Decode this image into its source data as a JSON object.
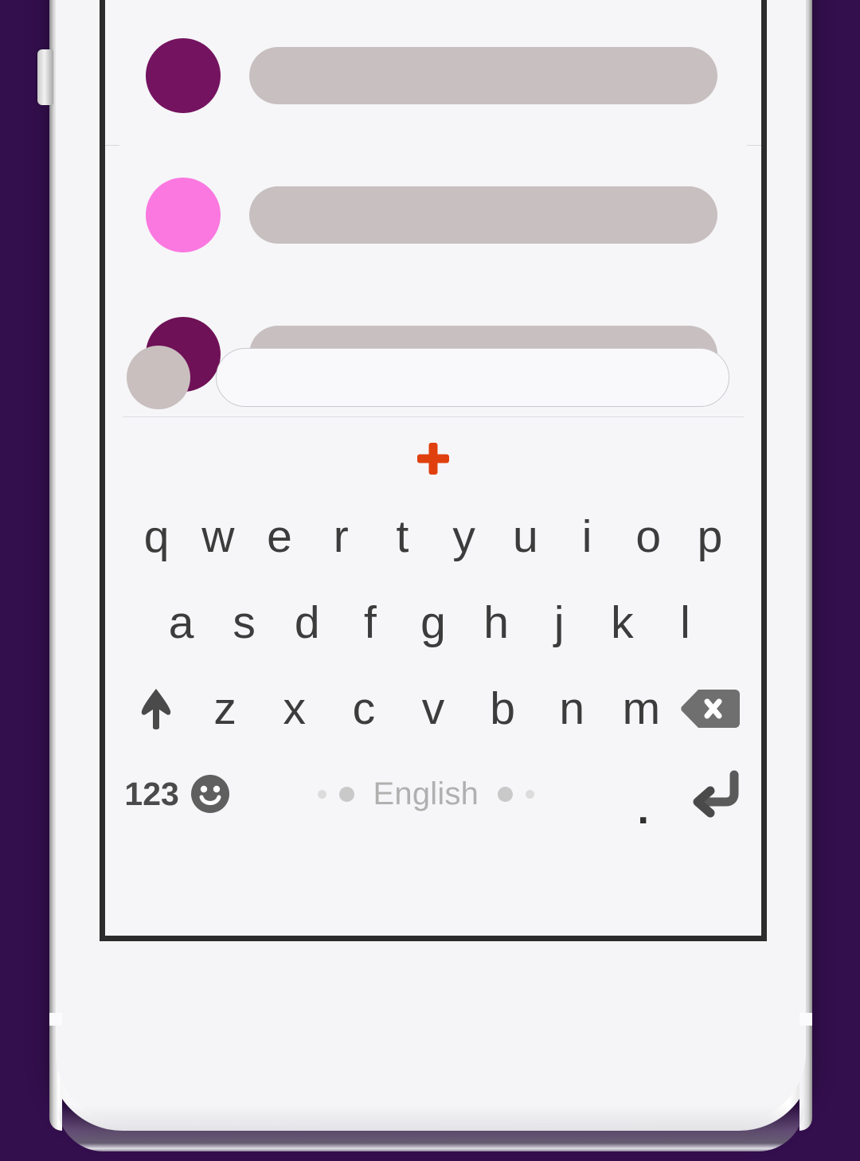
{
  "device": {
    "frame_color": "#f6f6f8",
    "bezel_color": "#2c2c2c",
    "side_button": "volume-button"
  },
  "background": {
    "color": "#330f4d"
  },
  "app": {
    "screen_bg": "#f6f6f8",
    "messages": [
      {
        "avatar_color": "#741360",
        "bubble_color": "#c8c0c0",
        "bubble_width": 588
      },
      {
        "avatar_color": "#fb78e0",
        "bubble_color": "#c8c0c0",
        "bubble_width": 588
      },
      {
        "avatar_color": "#6f1157",
        "bubble_color": "#c8c0c0",
        "bubble_width": 588
      }
    ],
    "composer": {
      "avatar_color": "#c9bfbf",
      "input_value": "",
      "input_placeholder": ""
    }
  },
  "keyboard": {
    "accent_color": "#e0400d",
    "add_icon": "plus-icon",
    "row1": [
      "q",
      "w",
      "e",
      "r",
      "t",
      "y",
      "u",
      "i",
      "o",
      "p"
    ],
    "row2": [
      "a",
      "s",
      "d",
      "f",
      "g",
      "h",
      "j",
      "k",
      "l"
    ],
    "row3_letters": [
      "z",
      "x",
      "c",
      "v",
      "b",
      "n",
      "m"
    ],
    "shift_icon": "shift-icon",
    "backspace_icon": "backspace-icon",
    "numeric_label": "123",
    "emoji_icon": "emoji-icon",
    "space_label": "English",
    "period_label": ".",
    "enter_icon": "enter-icon"
  }
}
